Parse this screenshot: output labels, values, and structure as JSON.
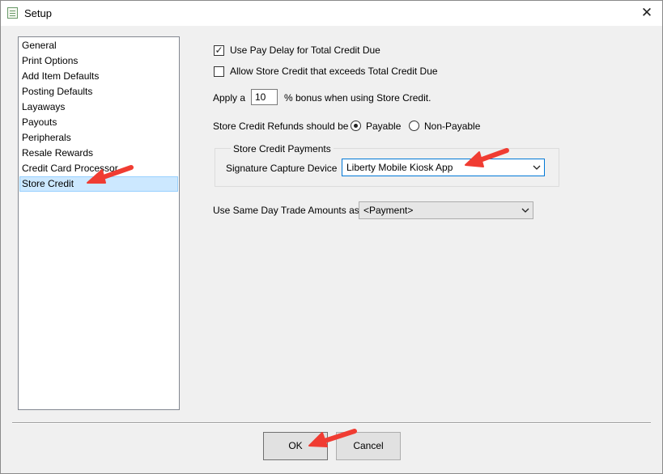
{
  "window": {
    "title": "Setup"
  },
  "nav": {
    "items": [
      {
        "label": "General"
      },
      {
        "label": "Print Options"
      },
      {
        "label": "Add Item Defaults"
      },
      {
        "label": "Posting Defaults"
      },
      {
        "label": "Layaways"
      },
      {
        "label": "Payouts"
      },
      {
        "label": "Peripherals"
      },
      {
        "label": "Resale Rewards"
      },
      {
        "label": "Credit Card Processor"
      },
      {
        "label": "Store Credit"
      }
    ],
    "selected": "Store Credit"
  },
  "settings": {
    "pay_delay": {
      "label": "Use Pay Delay for Total Credit Due",
      "checked": true
    },
    "allow_exceed": {
      "label": "Allow Store Credit that exceeds Total Credit Due",
      "checked": false
    },
    "bonus": {
      "prefix": "Apply a",
      "value": "10",
      "suffix": "% bonus when using Store Credit."
    },
    "refunds": {
      "label": "Store Credit Refunds should be",
      "option_payable": "Payable",
      "option_non_payable": "Non-Payable",
      "selected": "Payable"
    },
    "payments_group": {
      "title": "Store Credit Payments",
      "signature_label": "Signature Capture Device",
      "signature_value": "Liberty Mobile Kiosk App"
    },
    "same_day_trade": {
      "label": "Use Same Day Trade Amounts as",
      "value": "<Payment>"
    }
  },
  "footer": {
    "ok_label": "OK",
    "cancel_label": "Cancel"
  },
  "colors": {
    "annotation_arrow": "#f03c32",
    "selection": "#cce8ff",
    "focus_border": "#0078d7"
  }
}
